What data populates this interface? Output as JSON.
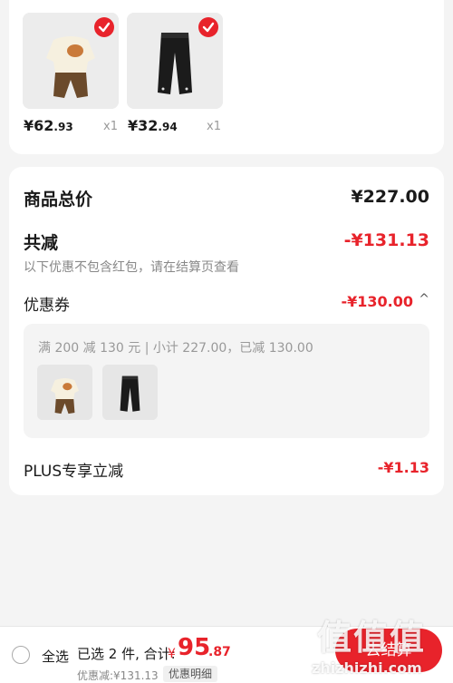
{
  "products": [
    {
      "name": "cream-sweater-brown-pants-outfit",
      "price_int": "¥62",
      "price_dec": ".93",
      "qty": "x1",
      "selected": true
    },
    {
      "name": "black-pants",
      "price_int": "¥32",
      "price_dec": ".94",
      "qty": "x1",
      "selected": true
    }
  ],
  "summary": {
    "total_label": "商品总价",
    "total_value": "¥227.00",
    "reduce_label": "共减",
    "reduce_value": "-¥131.13",
    "reduce_note": "以下优惠不包含红包，请在结算页查看",
    "coupon_label": "优惠券",
    "coupon_value": "-¥130.00",
    "coupon_chevron": "^",
    "coupon_desc": "满 200 减 130 元 | 小计 227.00，已减 130.00",
    "plus_label": "PLUS专享立减",
    "plus_value": "-¥1.13"
  },
  "bottom": {
    "select_all": "全选",
    "selected_summary": "已选 2 件, 合计:",
    "currency": "¥",
    "amount_int": "95",
    "amount_dec": ".87",
    "discount_line": "优惠减:¥131.13",
    "detail_tag": "优惠明细",
    "checkout": "去结算"
  },
  "watermark": {
    "big": "值值值",
    "small": "zhizhizhi.com"
  },
  "colors": {
    "accent": "#e8232b",
    "background": "#f4f4f4"
  }
}
